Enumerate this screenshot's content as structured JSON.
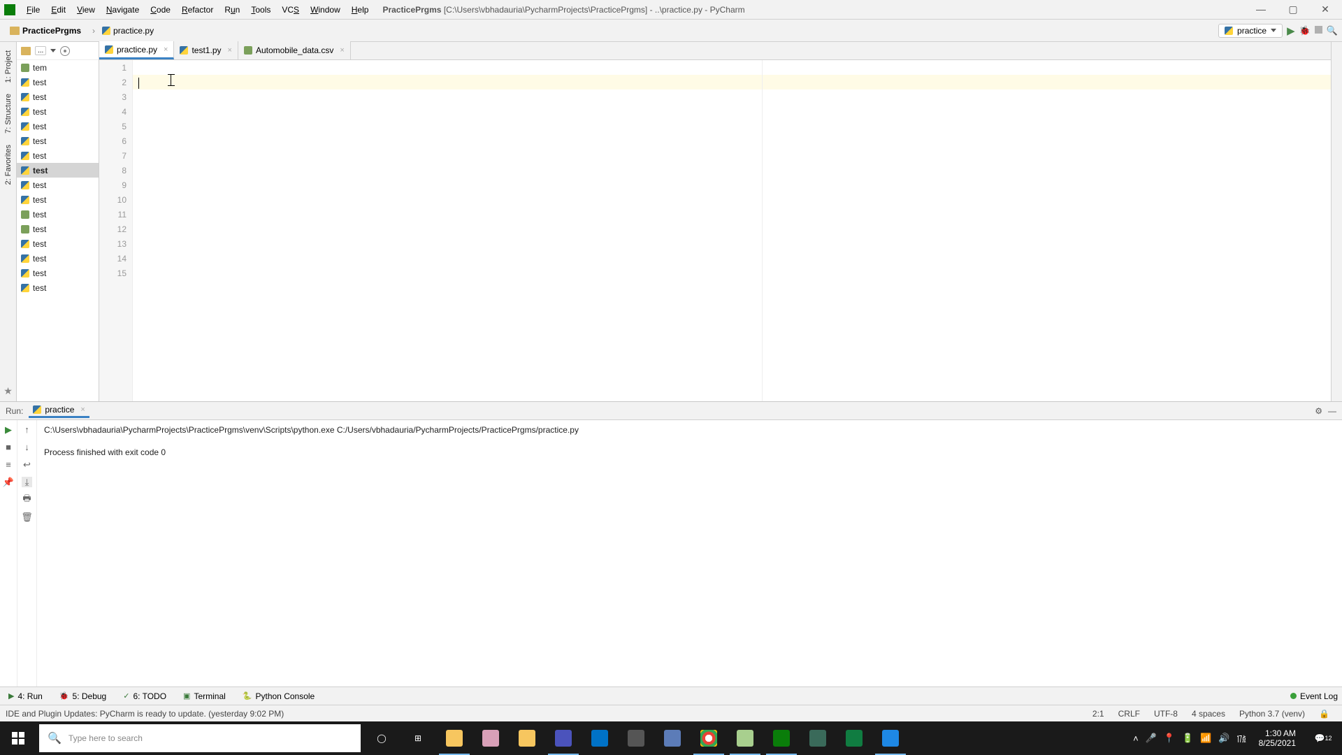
{
  "window": {
    "title_project": "PracticePrgms",
    "title_path": "[C:\\Users\\vbhadauria\\PycharmProjects\\PracticePrgms] - ..\\practice.py - PyCharm"
  },
  "menu": {
    "file": "File",
    "edit": "Edit",
    "view": "View",
    "navigate": "Navigate",
    "code": "Code",
    "refactor": "Refactor",
    "run": "Run",
    "tools": "Tools",
    "vcs": "VCS",
    "window": "Window",
    "help": "Help"
  },
  "breadcrumb": {
    "root": "PracticePrgms",
    "file": "practice.py"
  },
  "run_config": {
    "selected": "practice"
  },
  "project_tree": {
    "toolbar": {
      "drop": "..."
    },
    "items": [
      {
        "icon": "csv",
        "label": "tem"
      },
      {
        "icon": "py",
        "label": "test"
      },
      {
        "icon": "py",
        "label": "test"
      },
      {
        "icon": "py",
        "label": "test"
      },
      {
        "icon": "py",
        "label": "test"
      },
      {
        "icon": "py",
        "label": "test"
      },
      {
        "icon": "py",
        "label": "test"
      },
      {
        "icon": "py",
        "label": "test",
        "selected": true
      },
      {
        "icon": "py",
        "label": "test"
      },
      {
        "icon": "py",
        "label": "test"
      },
      {
        "icon": "csv",
        "label": "test"
      },
      {
        "icon": "csv",
        "label": "test"
      },
      {
        "icon": "py",
        "label": "test"
      },
      {
        "icon": "py",
        "label": "test"
      },
      {
        "icon": "py",
        "label": "test"
      },
      {
        "icon": "py",
        "label": "test"
      }
    ]
  },
  "editor_tabs": [
    {
      "icon": "py",
      "label": "practice.py",
      "active": true
    },
    {
      "icon": "py",
      "label": "test1.py",
      "active": false
    },
    {
      "icon": "csv",
      "label": "Automobile_data.csv",
      "active": false
    }
  ],
  "editor": {
    "line_count": 15,
    "highlight_line": 2
  },
  "left_stripe": {
    "project": "1: Project",
    "structure": "7: Structure",
    "favorites": "2: Favorites"
  },
  "run_panel": {
    "title": "Run:",
    "tab_name": "practice",
    "output_line1": "C:\\Users\\vbhadauria\\PycharmProjects\\PracticePrgms\\venv\\Scripts\\python.exe C:/Users/vbhadauria/PycharmProjects/PracticePrgms/practice.py",
    "output_line2": "",
    "output_line3": "Process finished with exit code 0"
  },
  "bottom_tabs": {
    "run": "4: Run",
    "debug": "5: Debug",
    "todo": "6: TODO",
    "terminal": "Terminal",
    "python_console": "Python Console",
    "event_log": "Event Log"
  },
  "status_bar": {
    "msg": "IDE and Plugin Updates: PyCharm is ready to update. (yesterday 9:02 PM)",
    "pos": "2:1",
    "eol": "CRLF",
    "enc": "UTF-8",
    "indent": "4 spaces",
    "py": "Python 3.7 (venv)"
  },
  "taskbar": {
    "search_placeholder": "Type here to search",
    "time": "1:30 AM",
    "date": "8/25/2021",
    "notif_badge": "12"
  }
}
